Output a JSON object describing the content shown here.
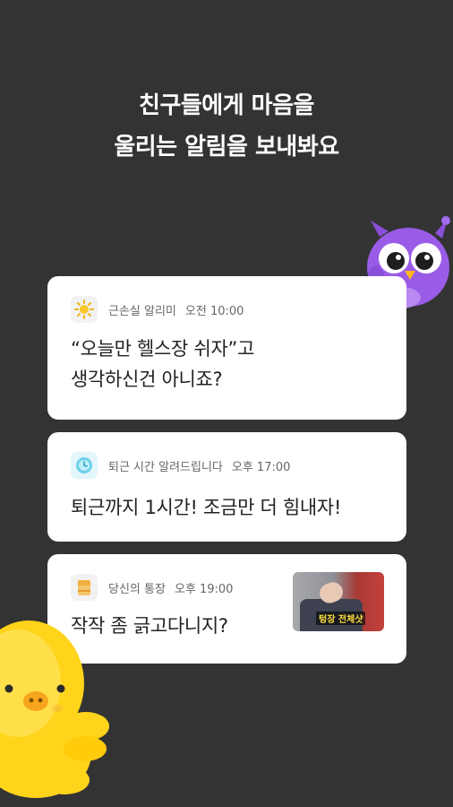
{
  "headline": {
    "line1": "친구들에게 마음을",
    "line2": "울리는 알림을 보내봐요"
  },
  "notifications": [
    {
      "app_name": "근손실 알리미",
      "time": "오전 10:00",
      "message_line1": "“오늘만 헬스장 쉬자”고",
      "message_line2": "생각하신건 아니죠?",
      "icon": "sun-icon"
    },
    {
      "app_name": "퇴근 시간 알려드립니다",
      "time": "오후 17:00",
      "message_line1": "퇴근까지 1시간! 조금만 더 힘내자!",
      "icon": "clock-icon"
    },
    {
      "app_name": "당신의 통장",
      "time": "오후 19:00",
      "message_line1": "작작 좀 긁고다니지?",
      "icon": "bankbook-icon",
      "thumbnail_caption": "텅장 전체샷"
    }
  ],
  "colors": {
    "background": "#333333",
    "card": "#ffffff",
    "owl": "#9a5ce6",
    "octopus": "#ffd41a"
  }
}
